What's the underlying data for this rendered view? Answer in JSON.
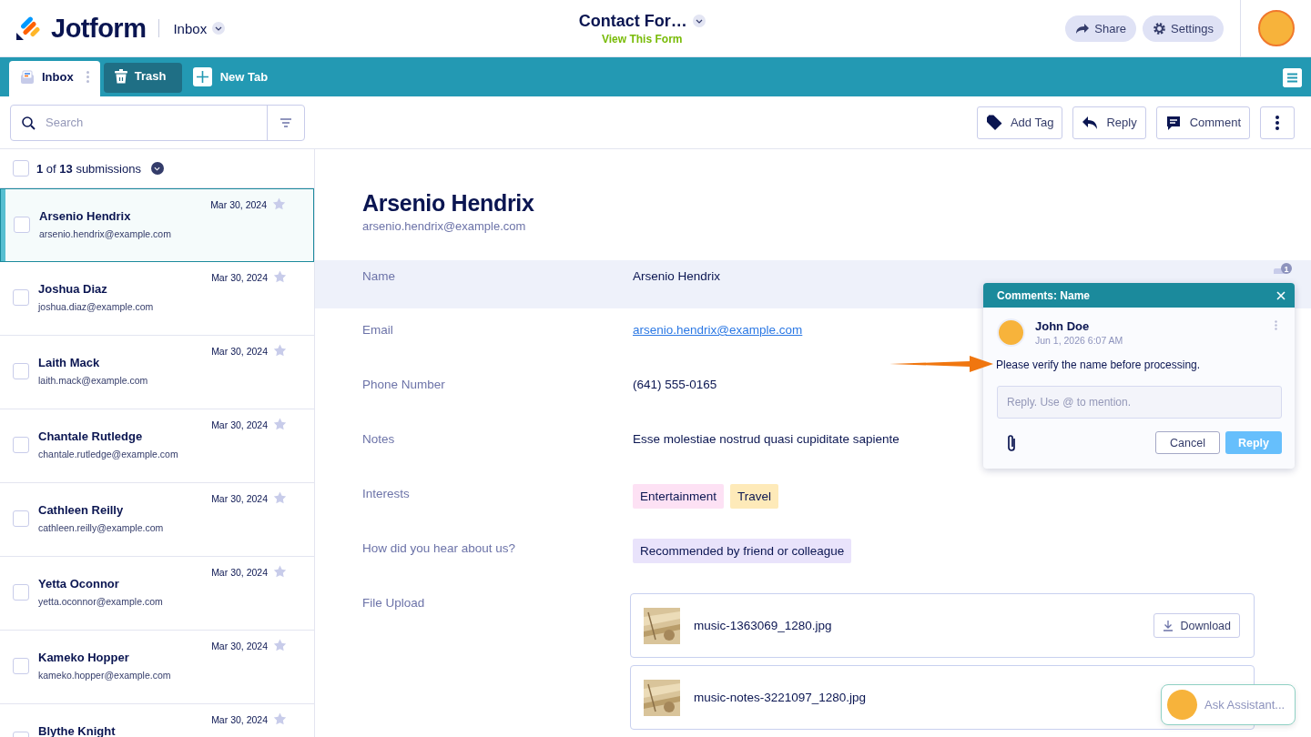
{
  "header": {
    "logo": "Jotform",
    "inbox_menu": "Inbox",
    "form_title": "Contact For…",
    "form_link": "View This Form",
    "buttons": [
      {
        "label": "Share",
        "kind": "share"
      },
      {
        "label": "Settings",
        "kind": "settings"
      }
    ]
  },
  "tabs": [
    {
      "label": "Inbox",
      "kind": "inbox",
      "selected": true
    },
    {
      "label": "Trash",
      "kind": "trash",
      "selected": false
    }
  ],
  "new_tab_button": "New Tab",
  "toolbar": {
    "search_placeholder": "Search",
    "actions": [
      {
        "label": "Add Tag",
        "kind": "tag"
      },
      {
        "label": "Reply",
        "kind": "reply"
      },
      {
        "label": "Comment",
        "kind": "comment"
      }
    ]
  },
  "list": {
    "all_selected": false,
    "summary": "**1** of **13** submissions",
    "submissions": [
      {
        "name": "Arsenio Hendrix",
        "email": "arsenio.hendrix@example.com",
        "date": "Mar 30, 2024",
        "selected": true
      },
      {
        "name": "Joshua Diaz",
        "email": "joshua.diaz@example.com",
        "date": "Mar 30, 2024",
        "selected": false
      },
      {
        "name": "Laith Mack",
        "email": "laith.mack@example.com",
        "date": "Mar 30, 2024",
        "selected": false
      },
      {
        "name": "Chantale Rutledge",
        "email": "chantale.rutledge@example.com",
        "date": "Mar 30, 2024",
        "selected": false
      },
      {
        "name": "Cathleen Reilly",
        "email": "cathleen.reilly@example.com",
        "date": "Mar 30, 2024",
        "selected": false
      },
      {
        "name": "Yetta Oconnor",
        "email": "yetta.oconnor@example.com",
        "date": "Mar 30, 2024",
        "selected": false
      },
      {
        "name": "Kameko Hopper",
        "email": "kameko.hopper@example.com",
        "date": "Mar 30, 2024",
        "selected": false
      },
      {
        "name": "Blythe Knight",
        "date": "Mar 30, 2024",
        "selected": false
      }
    ]
  },
  "detail": {
    "name": "Arsenio Hendrix",
    "email": "arsenio.hendrix@example.com",
    "fields": [
      {
        "label": "Name",
        "kind": "text",
        "value": "Arsenio Hendrix",
        "highlighted": true,
        "comment_count": "1"
      },
      {
        "label": "Email",
        "kind": "link",
        "value": "arsenio.hendrix@example.com",
        "highlighted": false
      },
      {
        "label": "Phone Number",
        "kind": "text",
        "value": "(641) 555-0165",
        "highlighted": false
      },
      {
        "label": "Notes",
        "kind": "text",
        "value": "Esse molestiae nostrud quasi cupiditate sapiente",
        "highlighted": false
      },
      {
        "label": "Interests",
        "kind": "tags",
        "highlighted": false,
        "tags": [
          {
            "label": "Entertainment",
            "color": "#fde1f4"
          },
          {
            "label": "Travel",
            "color": "#feeab9"
          }
        ]
      },
      {
        "label": "How did you hear about us?",
        "kind": "tags",
        "highlighted": false,
        "tags": [
          {
            "label": "Recommended by friend or colleague",
            "color": "#e9e3fb"
          }
        ]
      },
      {
        "label": "File Upload",
        "kind": "files",
        "highlighted": false,
        "files": [
          {
            "name": "music-1363069_1280.jpg",
            "button": "Download"
          },
          {
            "name": "music-notes-3221097_1280.jpg"
          }
        ]
      }
    ]
  },
  "comment_popup": {
    "title": "Comments: Name",
    "author": "John Doe",
    "time": "Jun 1, 2026 6:07 AM",
    "text": "Please verify the name before processing.",
    "reply_placeholder": "Reply. Use @ to mention.",
    "buttons": [
      "Cancel",
      "Reply"
    ]
  },
  "assistant": {
    "label": "Ask Assistant..."
  }
}
